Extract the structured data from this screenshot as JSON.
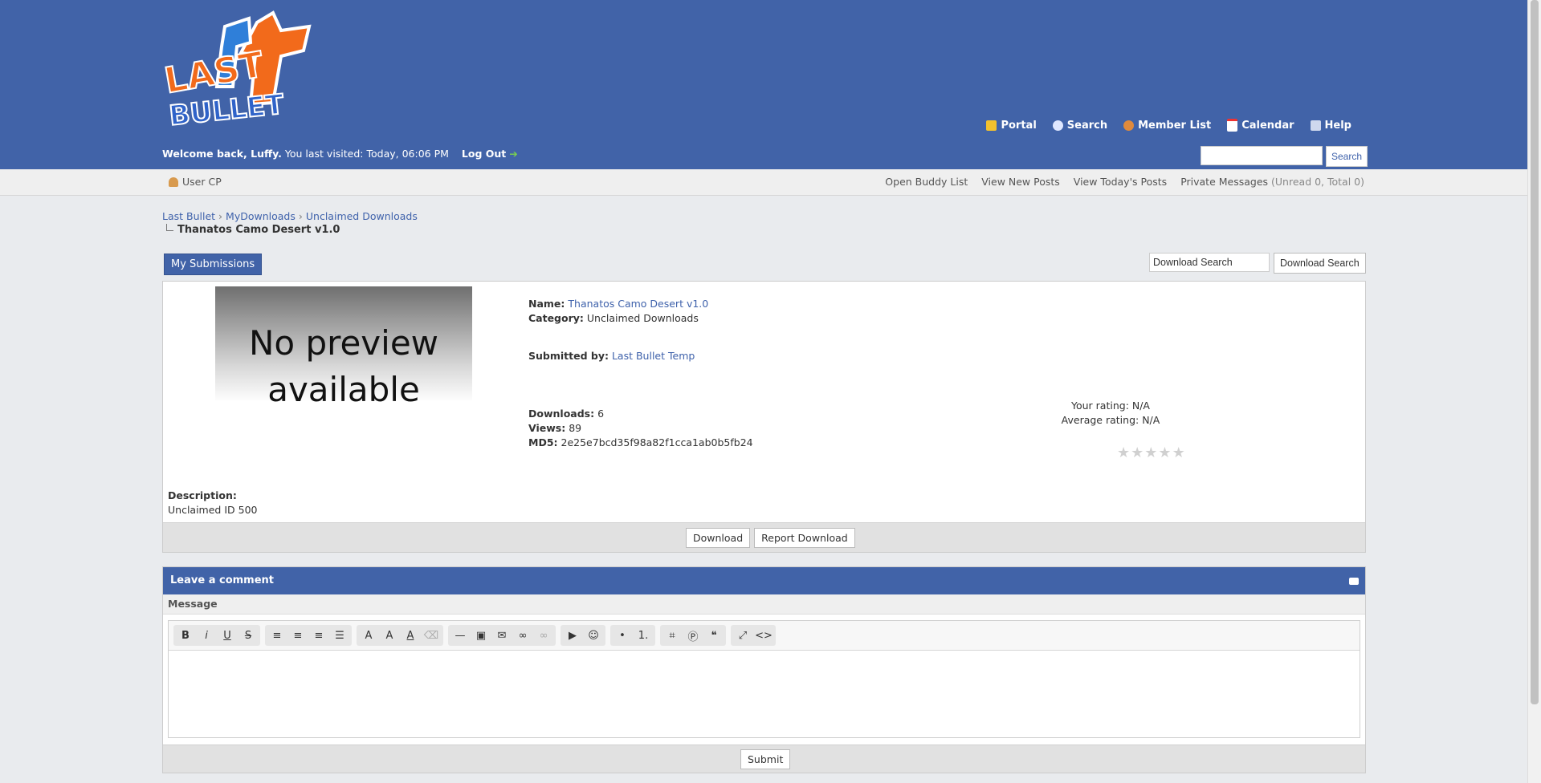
{
  "header": {
    "logo_text_top": "LAST",
    "logo_text_bottom": "BULLET",
    "nav": [
      {
        "label": "Portal",
        "icon": "bell-icon",
        "color": "#f2c12e"
      },
      {
        "label": "Search",
        "icon": "magnifier-icon",
        "color": "#dfe7ff"
      },
      {
        "label": "Member List",
        "icon": "members-icon",
        "color": "#e08a3c"
      },
      {
        "label": "Calendar",
        "icon": "calendar-icon",
        "color": "#ffffff"
      },
      {
        "label": "Help",
        "icon": "help-icon",
        "color": "#cfd8ee"
      }
    ],
    "welcome": "Welcome back, Luffy.",
    "last_visited": "You last visited: Today, 06:06 PM",
    "logout": "Log Out",
    "search_placeholder": "",
    "search_button": "Search"
  },
  "subbar": {
    "usercp": "User CP",
    "links": [
      "Open Buddy List",
      "View New Posts",
      "View Today's Posts",
      "Private Messages"
    ],
    "pm_status": "(Unread 0, Total 0)"
  },
  "breadcrumb": {
    "items": [
      "Last Bullet",
      "MyDownloads",
      "Unclaimed Downloads"
    ],
    "current": "Thanatos Camo Desert v1.0"
  },
  "actions": {
    "my_submissions": "My Submissions",
    "download_search_value": "Download Search",
    "download_search_button": "Download Search"
  },
  "download": {
    "preview_line1": "No preview",
    "preview_line2": "available",
    "name_label": "Name:",
    "name": "Thanatos Camo Desert v1.0",
    "category_label": "Category:",
    "category": "Unclaimed Downloads",
    "submitted_label": "Submitted by:",
    "submitted_by": "Last Bullet Temp",
    "downloads_label": "Downloads:",
    "downloads": "6",
    "views_label": "Views:",
    "views": "89",
    "md5_label": "MD5:",
    "md5": "2e25e7bcd35f98a82f1cca1ab0b5fb24",
    "your_rating": "Your rating: N/A",
    "average_rating": "Average rating: N/A",
    "stars": 0,
    "description_label": "Description:",
    "description": "Unclaimed ID 500",
    "download_button": "Download",
    "report_button": "Report Download"
  },
  "comment": {
    "title": "Leave a comment",
    "message_label": "Message",
    "submit": "Submit"
  }
}
